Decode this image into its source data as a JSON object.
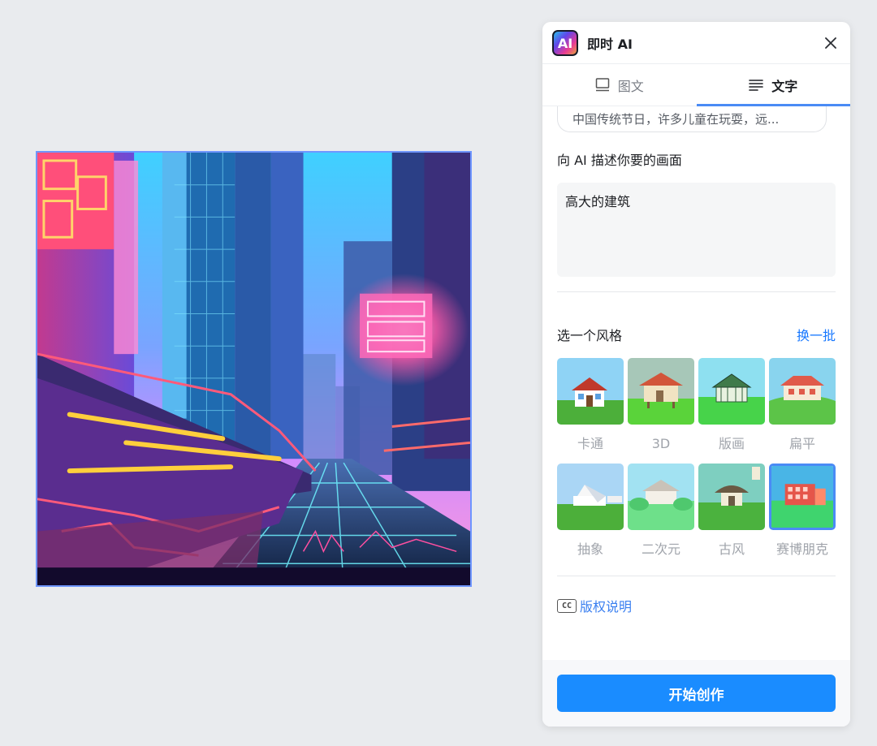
{
  "panel": {
    "title": "即时 AI",
    "logo_text": "AI",
    "tabs": [
      {
        "label": "图文",
        "icon": "monitor-icon",
        "active": false
      },
      {
        "label": "文字",
        "icon": "text-lines-icon",
        "active": true
      }
    ],
    "suggestion_chip": "中国传统节日，许多儿童在玩耍，远...",
    "prompt_label": "向 AI 描述你要的画面",
    "prompt_value": "高大的建筑",
    "style_label": "选一个风格",
    "style_refresh": "换一批",
    "styles": [
      {
        "name": "卡通",
        "selected": false
      },
      {
        "name": "3D",
        "selected": false
      },
      {
        "name": "版画",
        "selected": false
      },
      {
        "name": "扁平",
        "selected": false
      },
      {
        "name": "抽象",
        "selected": false
      },
      {
        "name": "二次元",
        "selected": false
      },
      {
        "name": "古风",
        "selected": false
      },
      {
        "name": "赛博朋克",
        "selected": true
      }
    ],
    "copyright_icon": "CC",
    "copyright_label": "版权说明",
    "start_button": "开始创作"
  },
  "colors": {
    "accent": "#1a8cff",
    "link": "#1677ff",
    "selection_border": "#4a8bf5"
  }
}
